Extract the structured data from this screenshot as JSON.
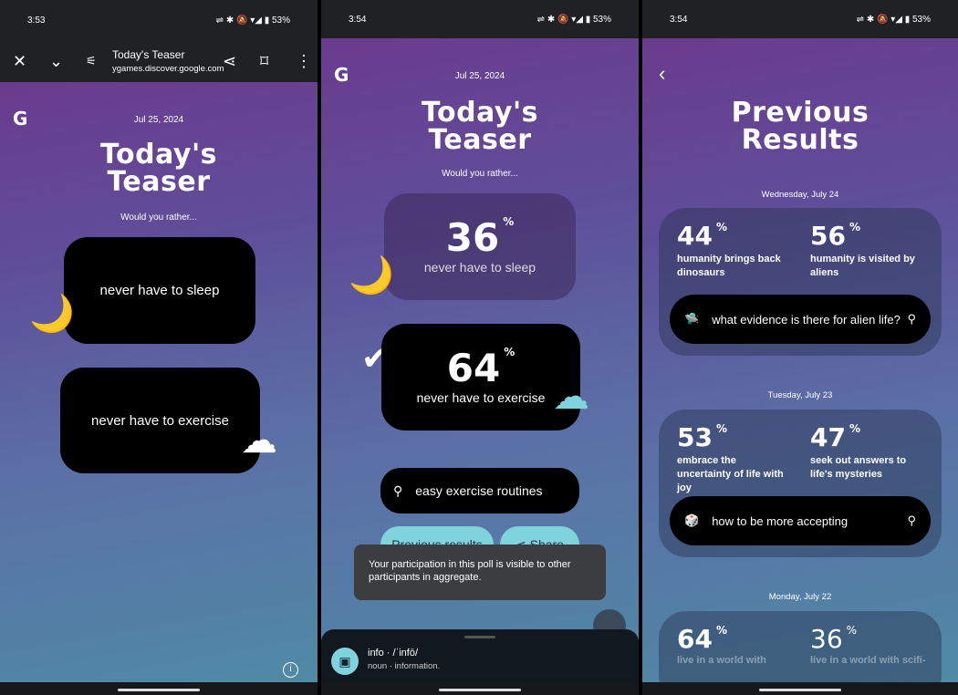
{
  "panel1": {
    "status": {
      "time": "3:53",
      "battery": "53%"
    },
    "toolbar": {
      "title": "Today's Teaser",
      "url": "ygames.discover.google.com",
      "icons": [
        "close-icon",
        "chevron-down-icon",
        "tune-icon",
        "share-icon",
        "bookmark-icon",
        "more-vert-icon"
      ]
    },
    "date": "Jul 25, 2024",
    "title_line1": "Today's",
    "title_line2": "Teaser",
    "prompt": "Would you rather...",
    "option1": "never have to sleep",
    "option2": "never have to exercise"
  },
  "panel2": {
    "status": {
      "time": "3:54",
      "battery": "53%"
    },
    "date": "Jul 25, 2024",
    "title_line1": "Today's",
    "title_line2": "Teaser",
    "prompt": "Would you rather...",
    "result1": {
      "pct": "36",
      "label": "never have to sleep",
      "value": 36
    },
    "result2": {
      "pct": "64",
      "label": "never have to exercise",
      "value": 64,
      "selected": true
    },
    "search": "easy exercise routines",
    "previous_results": "Previous results",
    "share": "Share",
    "toast": "Your participation in this poll is visible to other participants in aggregate.",
    "sheet": {
      "word": "info · /ˈinfō/",
      "definition": "noun · information."
    }
  },
  "panel3": {
    "status": {
      "time": "3:54",
      "battery": "53%"
    },
    "title_line1": "Previous",
    "title_line2": "Results",
    "days": [
      {
        "date": "Wednesday, July 24",
        "a": {
          "pct": "44",
          "label": "humanity brings back dinosaurs"
        },
        "b": {
          "pct": "56",
          "label": "humanity is visited by aliens"
        },
        "search": "what evidence is there for alien life?"
      },
      {
        "date": "Tuesday, July 23",
        "a": {
          "pct": "53",
          "label": "embrace the uncertainty of life with joy"
        },
        "b": {
          "pct": "47",
          "label": "seek out answers to life's mysteries"
        },
        "search": "how to be more accepting"
      },
      {
        "date": "Monday, July 22",
        "a": {
          "pct": "64",
          "label": "live in a world with"
        },
        "b": {
          "pct": "36",
          "label": "live in a world with scifi-"
        }
      }
    ]
  },
  "colors": {
    "accent": "#7fd3dc",
    "card": "#000000"
  }
}
